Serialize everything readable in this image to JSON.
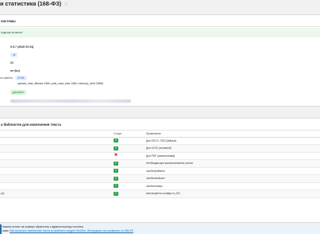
{
  "page": {
    "title": "и статистика (168-ФЗ)",
    "favorite_icon": "star-icon"
  },
  "system_card": {
    "heading": "системы",
    "notice": "ходится на месте",
    "version": "0.9.7 (2026 03 04)",
    "mode_badge": "ok",
    "row3_value": "21",
    "row4_value": "ne (ku)",
    "upload_label": "ки файла:",
    "upload_badge": "16 Mb",
    "limits": "upload_max_filesize 16M, post_max_size 16M, memory_limit 256M",
    "status_badge": "доступен"
  },
  "libs_card": {
    "heading": "а библиотек для извлечения текста",
    "columns": {
      "name": "",
      "status": "Статус",
      "note": "Применение"
    },
    "rows": [
      {
        "name": "",
        "status": "ok",
        "note": "Для DOCX, ODS (fallback)"
      },
      {
        "name": "",
        "status": "ok",
        "note": "Для XLSX (основной)"
      },
      {
        "name": "",
        "status": "err",
        "note": "Для PDF (альтернатива)"
      },
      {
        "name": "",
        "status": "ok",
        "note": "Необходим для вызова внешних утилит"
      },
      {
        "name": "",
        "status": "ok",
        "note": "/usr/bin/pdftotext"
      },
      {
        "name": "",
        "status": "ok",
        "note": "/usr/bin/antiword"
      },
      {
        "name": "",
        "status": "ok",
        "note": "/usr/bin/catdoc"
      },
      {
        "name": "pc)",
        "status": "ok",
        "note": "используется словарь ru_RU"
      }
    ]
  },
  "info": {
    "line1": "нешних утилит на сервере обратитесь к администратору хостинга.",
    "line2_prefix": "ании: ",
    "line2_link": "Как настроить извлечение текста из файлов в модуле SeoGen, Инструкция, как проверить по 168-ФЗ"
  },
  "colors": {
    "ok": "#2ea44f",
    "err": "#d63638",
    "accent": "#2271b1"
  }
}
